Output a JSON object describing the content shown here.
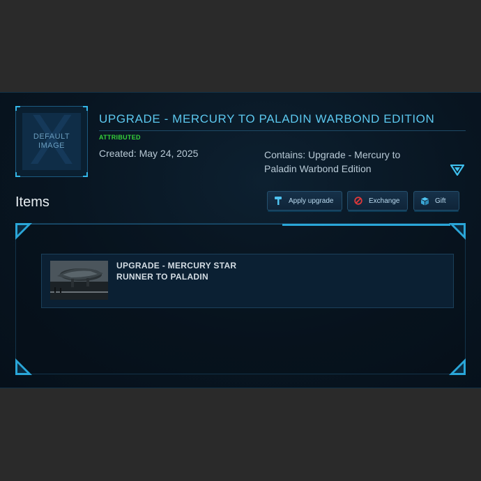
{
  "thumbnail": {
    "placeholder_line1": "DEFAULT",
    "placeholder_line2": "IMAGE",
    "watermark": "X"
  },
  "pledge": {
    "title": "UPGRADE - MERCURY TO PALADIN WARBOND EDITION",
    "status": "ATTRIBUTED",
    "created": "Created: May 24, 2025",
    "contains": "Contains: Upgrade - Mercury to Paladin Warbond Edition"
  },
  "items_section": {
    "heading": "Items",
    "buttons": [
      {
        "label": "Apply upgrade",
        "icon": "wrench-icon"
      },
      {
        "label": "Exchange",
        "icon": "no-entry-icon"
      },
      {
        "label": "Gift",
        "icon": "gift-box-icon"
      }
    ],
    "items": [
      {
        "name": "UPGRADE - MERCURY STAR RUNNER TO PALADIN",
        "image": "spaceship-thumbnail"
      }
    ]
  },
  "colors": {
    "accent": "#5cc8ef",
    "status_green": "#35d23a",
    "panel_bg": "#081521",
    "page_bg": "#2a2a2a",
    "exchange_icon": "#e0383a"
  }
}
